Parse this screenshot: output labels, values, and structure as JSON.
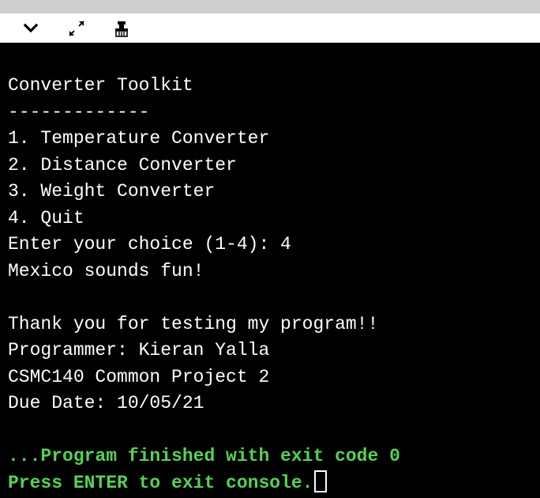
{
  "toolbar": {
    "icons": [
      "chevron-down-icon",
      "expand-icon",
      "clear-console-icon"
    ]
  },
  "console": {
    "lines": [
      "Converter Toolkit",
      "-------------",
      "1. Temperature Converter",
      "2. Distance Converter",
      "3. Weight Converter",
      "4. Quit",
      "Enter your choice (1-4): 4",
      "Mexico sounds fun!",
      "",
      "Thank you for testing my program!!",
      "Programmer: Kieran Yalla",
      "CSMC140 Common Project 2",
      "Due Date: 10/05/21",
      ""
    ],
    "exit_message": "...Program finished with exit code 0",
    "press_enter": "Press ENTER to exit console."
  },
  "colors": {
    "console_background": "#000000",
    "console_text": "#ffffff",
    "exit_text": "#55d255",
    "top_strip": "#cfcfcf"
  }
}
